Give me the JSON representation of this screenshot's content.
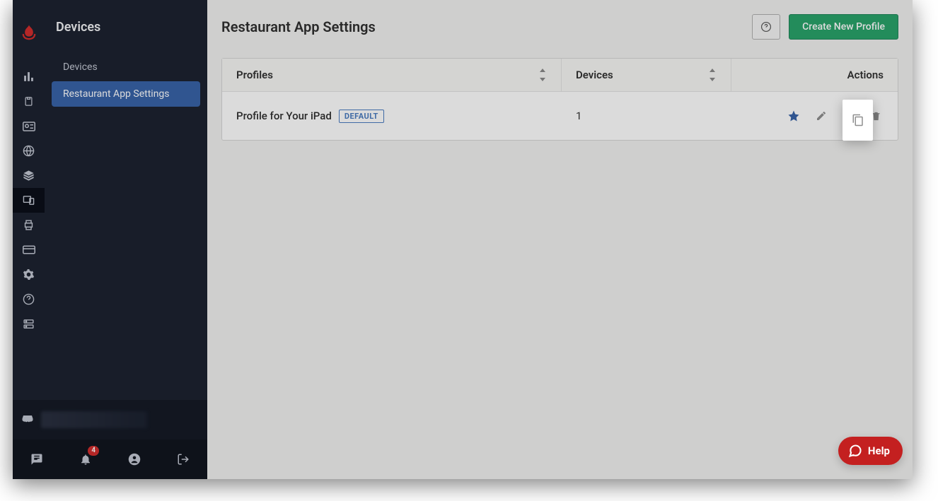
{
  "app": {
    "section_title": "Devices"
  },
  "sidebar": {
    "items": [
      {
        "label": "Devices",
        "selected": false
      },
      {
        "label": "Restaurant App Settings",
        "selected": true
      }
    ]
  },
  "rail": {
    "icons": [
      "bar-chart-icon",
      "clipboard-icon",
      "id-card-icon",
      "globe-icon",
      "layers-icon",
      "devices-icon",
      "printer-icon",
      "card-icon",
      "gear-icon",
      "question-circle-icon",
      "server-icon"
    ],
    "active_index": 5
  },
  "page": {
    "title": "Restaurant App Settings",
    "create_button": "Create New Profile"
  },
  "table": {
    "columns": {
      "profiles": "Profiles",
      "devices": "Devices",
      "actions": "Actions"
    },
    "actions": {
      "favorite": "star-icon",
      "edit": "pencil-icon",
      "duplicate": "copy-icon",
      "delete": "trash-icon"
    },
    "rows": [
      {
        "profile_name": "Profile for Your iPad",
        "default_label": "DEFAULT",
        "device_count": "1",
        "is_favorite": true
      }
    ]
  },
  "bottom": {
    "notification_count": "4"
  },
  "help": {
    "label": "Help"
  }
}
